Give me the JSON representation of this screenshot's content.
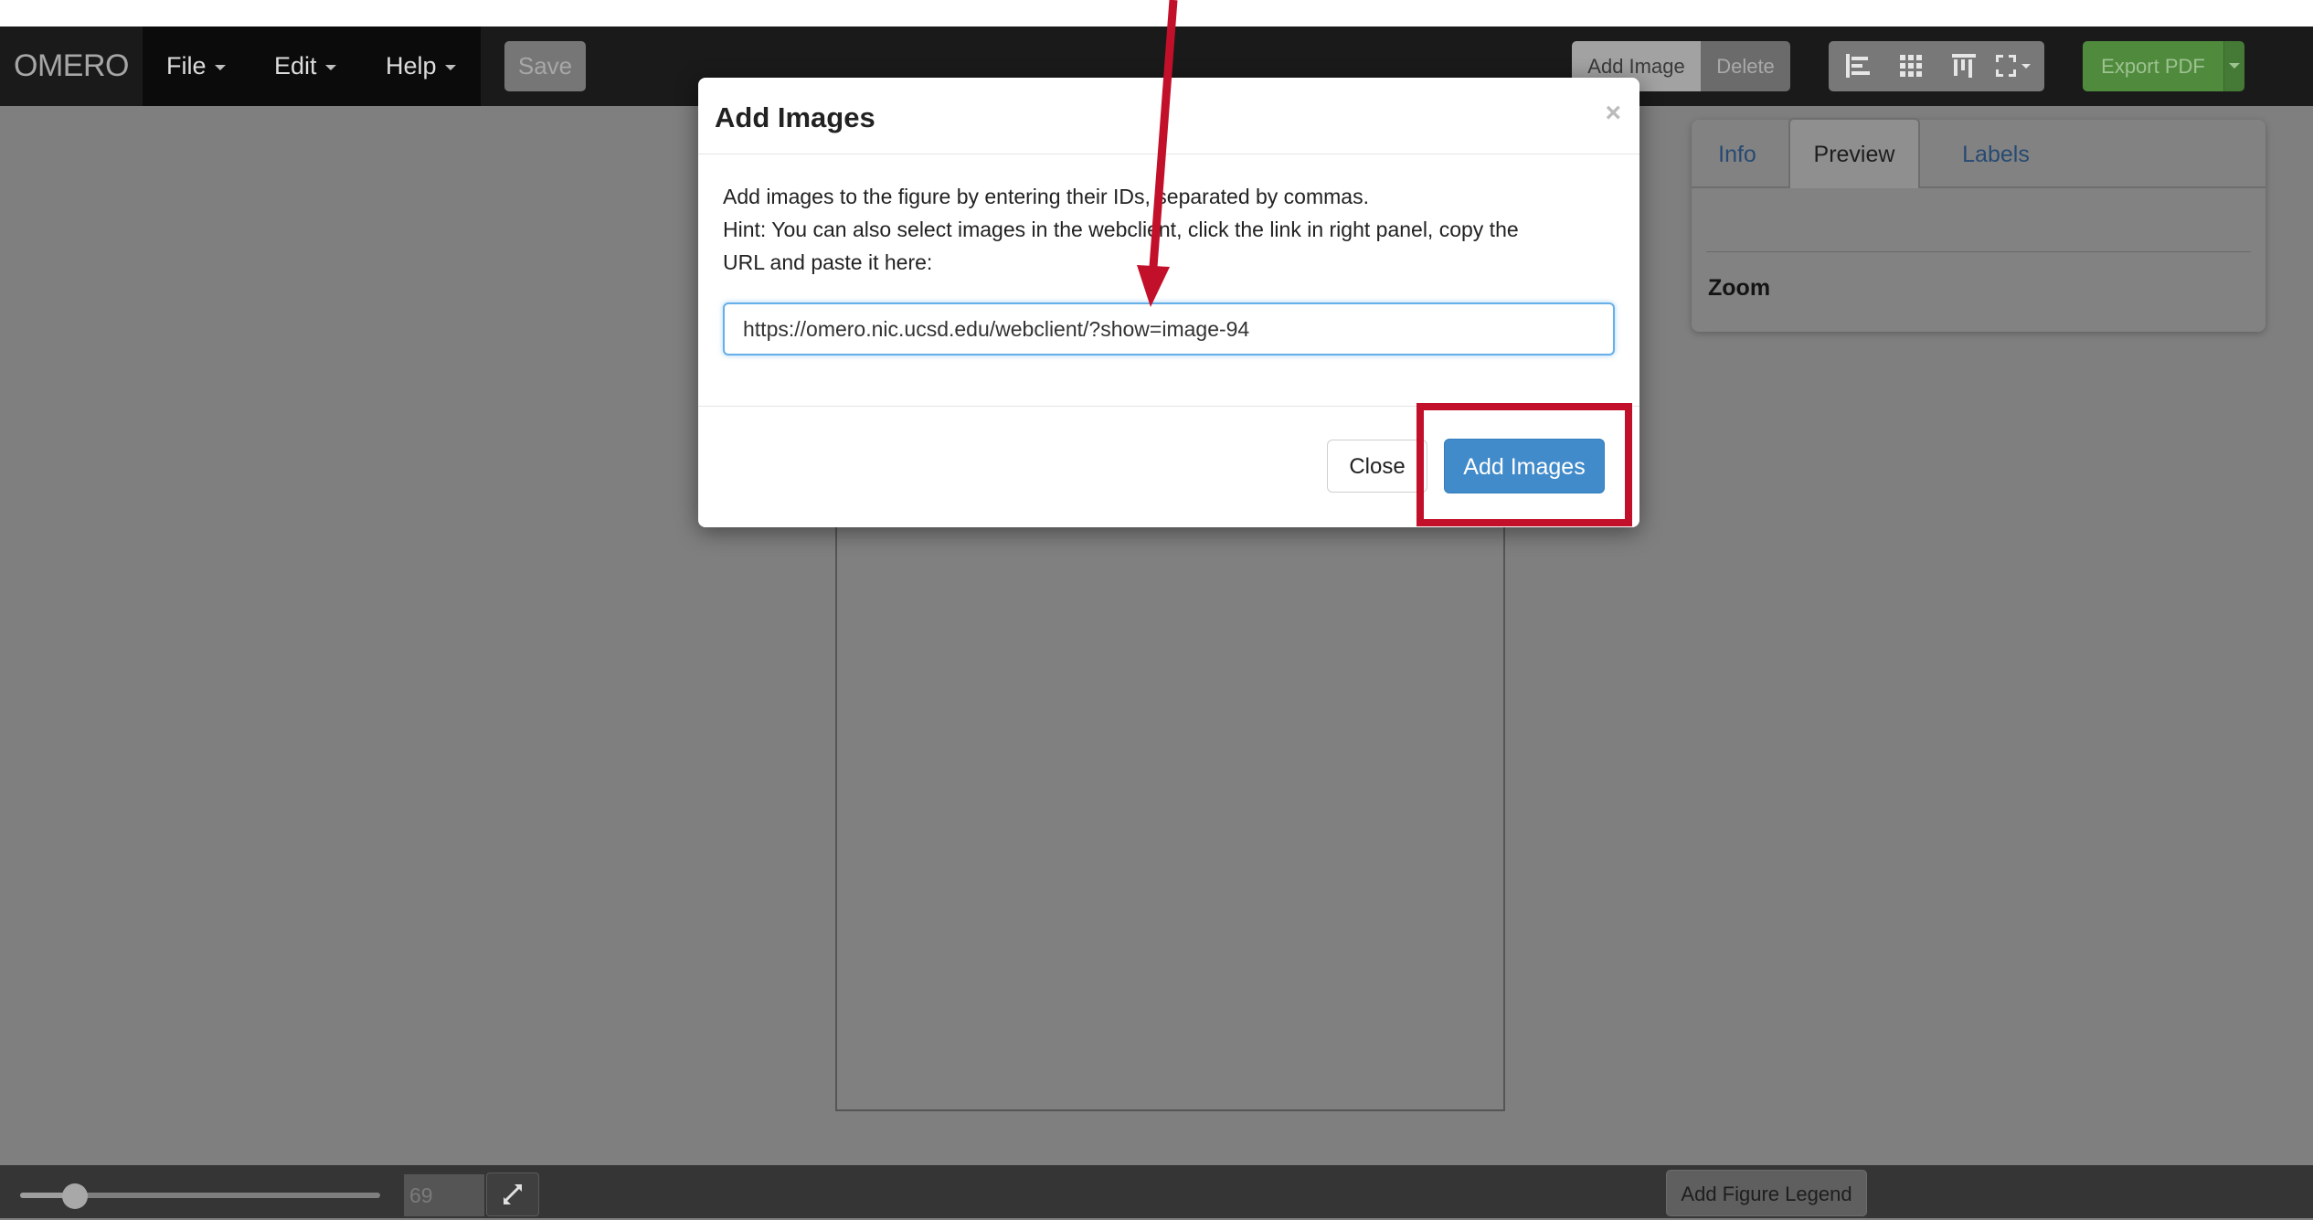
{
  "navbar": {
    "brand": "OMERO",
    "menus": [
      "File",
      "Edit",
      "Help"
    ],
    "save_label": "Save",
    "add_image_label": "Add Image",
    "delete_label": "Delete",
    "export_label": "Export PDF"
  },
  "right_panel": {
    "tabs": [
      "Info",
      "Preview",
      "Labels"
    ],
    "active_tab": "Preview",
    "zoom_label": "Zoom"
  },
  "bottom_bar": {
    "zoom_value": "69",
    "add_legend_label": "Add Figure Legend"
  },
  "modal": {
    "title": "Add Images",
    "close_symbol": "×",
    "instructions": [
      "Add images to the figure by entering their IDs, separated by commas.",
      "Hint: You can also select images in the webclient, click the link in right panel, copy the",
      "URL and paste it here:"
    ],
    "url_value": "https://omero.nic.ucsd.edu/webclient/?show=image-94",
    "close_button": "Close",
    "add_button": "Add Images"
  },
  "colors": {
    "primary_button": "#428bca",
    "highlight_box": "#c3102a",
    "annotation_arrow": "#c3102a",
    "export_button": "#4f8a3d"
  }
}
